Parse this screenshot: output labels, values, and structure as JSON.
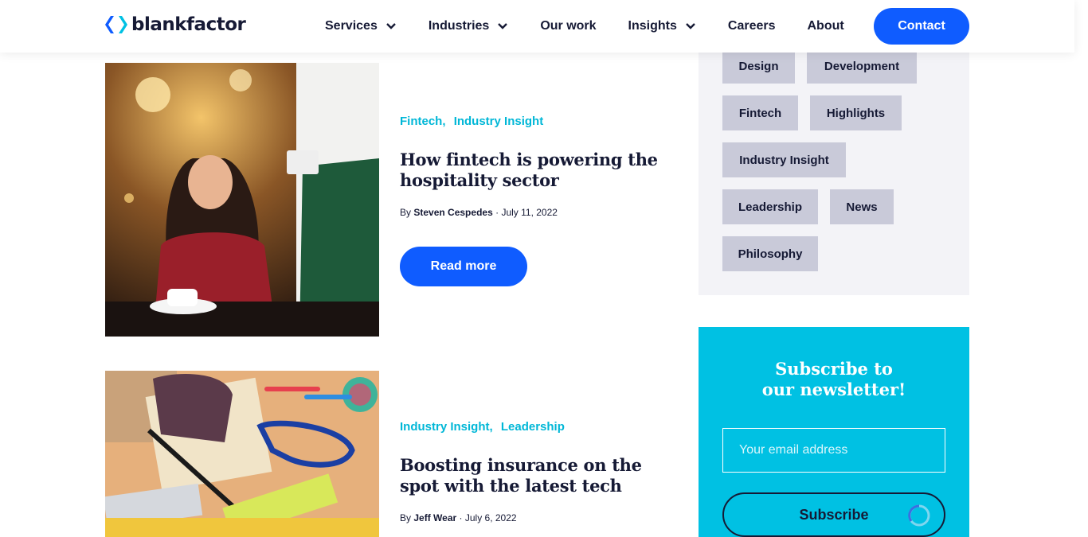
{
  "header": {
    "logo_text": "blankfactor",
    "nav": [
      {
        "label": "Services",
        "has_dropdown": true
      },
      {
        "label": "Industries",
        "has_dropdown": true
      },
      {
        "label": "Our work",
        "has_dropdown": false
      },
      {
        "label": "Insights",
        "has_dropdown": true
      },
      {
        "label": "Careers",
        "has_dropdown": false
      },
      {
        "label": "About",
        "has_dropdown": false
      }
    ],
    "contact_label": "Contact"
  },
  "articles": [
    {
      "categories": [
        "Fintech",
        "Industry Insight"
      ],
      "title": "How fintech is powering the hospitality sector",
      "by": "By",
      "author": "Steven Cespedes",
      "date": "July 11, 2022",
      "read_more": "Read more"
    },
    {
      "categories": [
        "Industry Insight",
        "Leadership"
      ],
      "title": "Boosting insurance on the spot with the latest tech",
      "by": "By",
      "author": "Jeff Wear",
      "date": "July 6, 2022"
    }
  ],
  "tags": [
    "Design",
    "Development",
    "Fintech",
    "Highlights",
    "Industry Insight",
    "Leadership",
    "News",
    "Philosophy"
  ],
  "newsletter": {
    "title": "Subscribe to our newsletter!",
    "email_placeholder": "Your email address",
    "subscribe_label": "Subscribe"
  },
  "colors": {
    "accent_blue": "#0f5cff",
    "accent_cyan": "#00c1e3",
    "category_cyan": "#00b7d7",
    "navy": "#161a35"
  }
}
